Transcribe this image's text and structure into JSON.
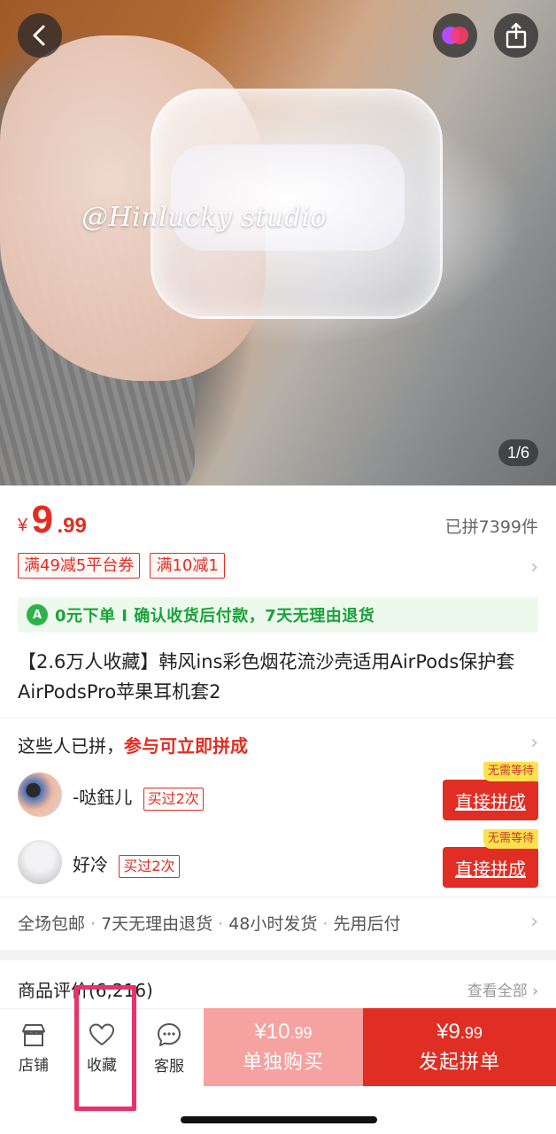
{
  "hero": {
    "watermark": "@Hinlucky studio",
    "page_indicator": "1/6"
  },
  "price": {
    "currency": "¥",
    "integer": "9",
    "decimal": ".99",
    "sold": "已拼7399件"
  },
  "coupons": [
    "满49减5平台券",
    "满10减1"
  ],
  "guarantee": {
    "badge": "A",
    "text": "0元下单 I 确认收货后付款，7天无理由退货"
  },
  "title": "【2.6万人收藏】韩风ins彩色烟花流沙壳适用AirPods保护套AirPodsPro苹果耳机套2",
  "group": {
    "prefix": "这些人已拼，",
    "highlight": "参与可立即拼成",
    "members": [
      {
        "name": "-哒鈺儿",
        "bought": "买过2次",
        "tag": "无需等待",
        "button": "直接拼成"
      },
      {
        "name": "好冷",
        "bought": "买过2次",
        "tag": "无需等待",
        "button": "直接拼成"
      }
    ]
  },
  "services": [
    "全场包邮",
    "7天无理由退货",
    "48小时发货",
    "先用后付"
  ],
  "reviews": {
    "title": "商品评价(6,216)",
    "view_all": "查看全部 ›"
  },
  "bottom_bar": {
    "store": "店铺",
    "favorite": "收藏",
    "service": "客服",
    "buy_alone_price": "¥10",
    "buy_alone_dec": ".99",
    "buy_alone_label": "单独购买",
    "buy_group_price": "¥9",
    "buy_group_dec": ".99",
    "buy_group_label": "发起拼单"
  },
  "colors": {
    "brand_red": "#e02e24",
    "light_red": "#f6a2a0",
    "guarantee_green": "#1aa33a",
    "highlight_pink": "#e8336a"
  },
  "icons": [
    "back-arrow-icon",
    "brand-logo-icon",
    "share-icon",
    "store-icon",
    "heart-icon",
    "chat-icon",
    "chevron-right-icon"
  ]
}
